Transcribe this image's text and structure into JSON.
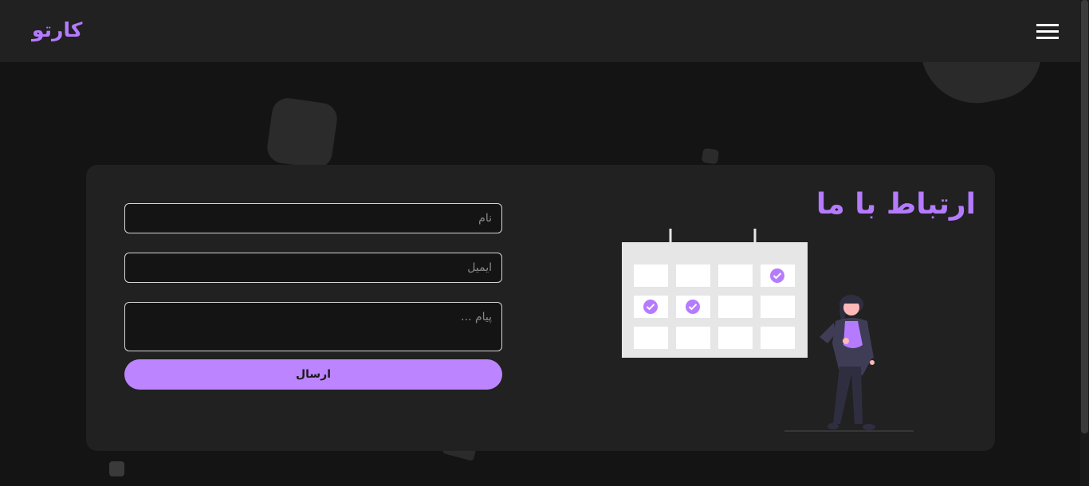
{
  "header": {
    "logo": "کارتو",
    "menu_icon": "hamburger-menu-icon"
  },
  "contact": {
    "title": "ارتباط با ما",
    "name_placeholder": "نام",
    "email_placeholder": "ایمیل",
    "message_placeholder": "پیام ...",
    "submit_label": "ارسال",
    "illustration": "calendar-with-person-illustration"
  },
  "colors": {
    "accent": "#b57bff",
    "button": "#bc85ff",
    "background": "#141414",
    "card": "#212121"
  }
}
